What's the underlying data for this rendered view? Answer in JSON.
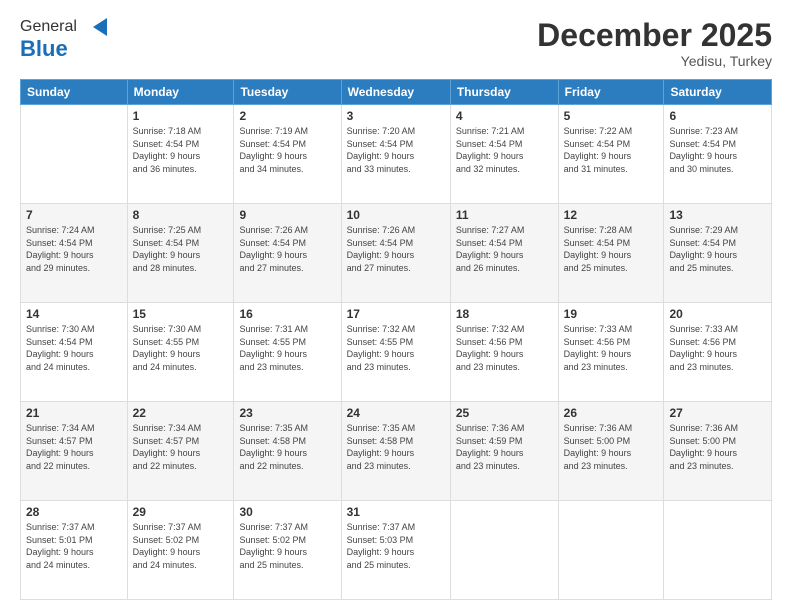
{
  "header": {
    "logo_general": "General",
    "logo_blue": "Blue",
    "month_title": "December 2025",
    "subtitle": "Yedisu, Turkey"
  },
  "days_of_week": [
    "Sunday",
    "Monday",
    "Tuesday",
    "Wednesday",
    "Thursday",
    "Friday",
    "Saturday"
  ],
  "weeks": [
    [
      {
        "day": "",
        "info": ""
      },
      {
        "day": "1",
        "info": "Sunrise: 7:18 AM\nSunset: 4:54 PM\nDaylight: 9 hours\nand 36 minutes."
      },
      {
        "day": "2",
        "info": "Sunrise: 7:19 AM\nSunset: 4:54 PM\nDaylight: 9 hours\nand 34 minutes."
      },
      {
        "day": "3",
        "info": "Sunrise: 7:20 AM\nSunset: 4:54 PM\nDaylight: 9 hours\nand 33 minutes."
      },
      {
        "day": "4",
        "info": "Sunrise: 7:21 AM\nSunset: 4:54 PM\nDaylight: 9 hours\nand 32 minutes."
      },
      {
        "day": "5",
        "info": "Sunrise: 7:22 AM\nSunset: 4:54 PM\nDaylight: 9 hours\nand 31 minutes."
      },
      {
        "day": "6",
        "info": "Sunrise: 7:23 AM\nSunset: 4:54 PM\nDaylight: 9 hours\nand 30 minutes."
      }
    ],
    [
      {
        "day": "7",
        "info": "Sunrise: 7:24 AM\nSunset: 4:54 PM\nDaylight: 9 hours\nand 29 minutes."
      },
      {
        "day": "8",
        "info": "Sunrise: 7:25 AM\nSunset: 4:54 PM\nDaylight: 9 hours\nand 28 minutes."
      },
      {
        "day": "9",
        "info": "Sunrise: 7:26 AM\nSunset: 4:54 PM\nDaylight: 9 hours\nand 27 minutes."
      },
      {
        "day": "10",
        "info": "Sunrise: 7:26 AM\nSunset: 4:54 PM\nDaylight: 9 hours\nand 27 minutes."
      },
      {
        "day": "11",
        "info": "Sunrise: 7:27 AM\nSunset: 4:54 PM\nDaylight: 9 hours\nand 26 minutes."
      },
      {
        "day": "12",
        "info": "Sunrise: 7:28 AM\nSunset: 4:54 PM\nDaylight: 9 hours\nand 25 minutes."
      },
      {
        "day": "13",
        "info": "Sunrise: 7:29 AM\nSunset: 4:54 PM\nDaylight: 9 hours\nand 25 minutes."
      }
    ],
    [
      {
        "day": "14",
        "info": "Sunrise: 7:30 AM\nSunset: 4:54 PM\nDaylight: 9 hours\nand 24 minutes."
      },
      {
        "day": "15",
        "info": "Sunrise: 7:30 AM\nSunset: 4:55 PM\nDaylight: 9 hours\nand 24 minutes."
      },
      {
        "day": "16",
        "info": "Sunrise: 7:31 AM\nSunset: 4:55 PM\nDaylight: 9 hours\nand 23 minutes."
      },
      {
        "day": "17",
        "info": "Sunrise: 7:32 AM\nSunset: 4:55 PM\nDaylight: 9 hours\nand 23 minutes."
      },
      {
        "day": "18",
        "info": "Sunrise: 7:32 AM\nSunset: 4:56 PM\nDaylight: 9 hours\nand 23 minutes."
      },
      {
        "day": "19",
        "info": "Sunrise: 7:33 AM\nSunset: 4:56 PM\nDaylight: 9 hours\nand 23 minutes."
      },
      {
        "day": "20",
        "info": "Sunrise: 7:33 AM\nSunset: 4:56 PM\nDaylight: 9 hours\nand 23 minutes."
      }
    ],
    [
      {
        "day": "21",
        "info": "Sunrise: 7:34 AM\nSunset: 4:57 PM\nDaylight: 9 hours\nand 22 minutes."
      },
      {
        "day": "22",
        "info": "Sunrise: 7:34 AM\nSunset: 4:57 PM\nDaylight: 9 hours\nand 22 minutes."
      },
      {
        "day": "23",
        "info": "Sunrise: 7:35 AM\nSunset: 4:58 PM\nDaylight: 9 hours\nand 22 minutes."
      },
      {
        "day": "24",
        "info": "Sunrise: 7:35 AM\nSunset: 4:58 PM\nDaylight: 9 hours\nand 23 minutes."
      },
      {
        "day": "25",
        "info": "Sunrise: 7:36 AM\nSunset: 4:59 PM\nDaylight: 9 hours\nand 23 minutes."
      },
      {
        "day": "26",
        "info": "Sunrise: 7:36 AM\nSunset: 5:00 PM\nDaylight: 9 hours\nand 23 minutes."
      },
      {
        "day": "27",
        "info": "Sunrise: 7:36 AM\nSunset: 5:00 PM\nDaylight: 9 hours\nand 23 minutes."
      }
    ],
    [
      {
        "day": "28",
        "info": "Sunrise: 7:37 AM\nSunset: 5:01 PM\nDaylight: 9 hours\nand 24 minutes."
      },
      {
        "day": "29",
        "info": "Sunrise: 7:37 AM\nSunset: 5:02 PM\nDaylight: 9 hours\nand 24 minutes."
      },
      {
        "day": "30",
        "info": "Sunrise: 7:37 AM\nSunset: 5:02 PM\nDaylight: 9 hours\nand 25 minutes."
      },
      {
        "day": "31",
        "info": "Sunrise: 7:37 AM\nSunset: 5:03 PM\nDaylight: 9 hours\nand 25 minutes."
      },
      {
        "day": "",
        "info": ""
      },
      {
        "day": "",
        "info": ""
      },
      {
        "day": "",
        "info": ""
      }
    ]
  ]
}
